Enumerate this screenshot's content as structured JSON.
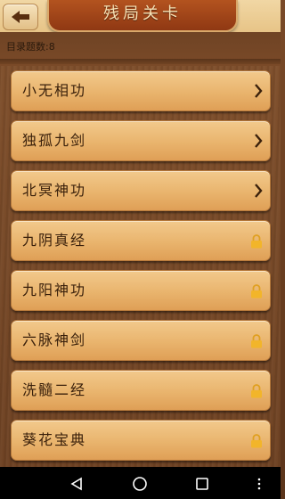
{
  "header": {
    "title": "残局关卡",
    "back_icon": "back-arrow-icon"
  },
  "subheader": {
    "count_label": "目录题数:8"
  },
  "levels": [
    {
      "label": "小无相功",
      "status": "unlocked",
      "icon": "chevron-right-icon"
    },
    {
      "label": "独孤九剑",
      "status": "unlocked",
      "icon": "chevron-right-icon"
    },
    {
      "label": "北冥神功",
      "status": "unlocked",
      "icon": "chevron-right-icon"
    },
    {
      "label": "九阴真经",
      "status": "locked",
      "icon": "lock-icon"
    },
    {
      "label": "九阳神功",
      "status": "locked",
      "icon": "lock-icon"
    },
    {
      "label": "六脉神剑",
      "status": "locked",
      "icon": "lock-icon"
    },
    {
      "label": "洗髓二经",
      "status": "locked",
      "icon": "lock-icon"
    },
    {
      "label": "葵花宝典",
      "status": "locked",
      "icon": "lock-icon"
    }
  ],
  "navbar": {
    "icons": [
      "nav-back-icon",
      "nav-home-icon",
      "nav-recent-icon",
      "nav-menu-icon"
    ]
  },
  "colors": {
    "accent": "#9b4016",
    "item": "#e9b46d",
    "text": "#3a200b"
  }
}
